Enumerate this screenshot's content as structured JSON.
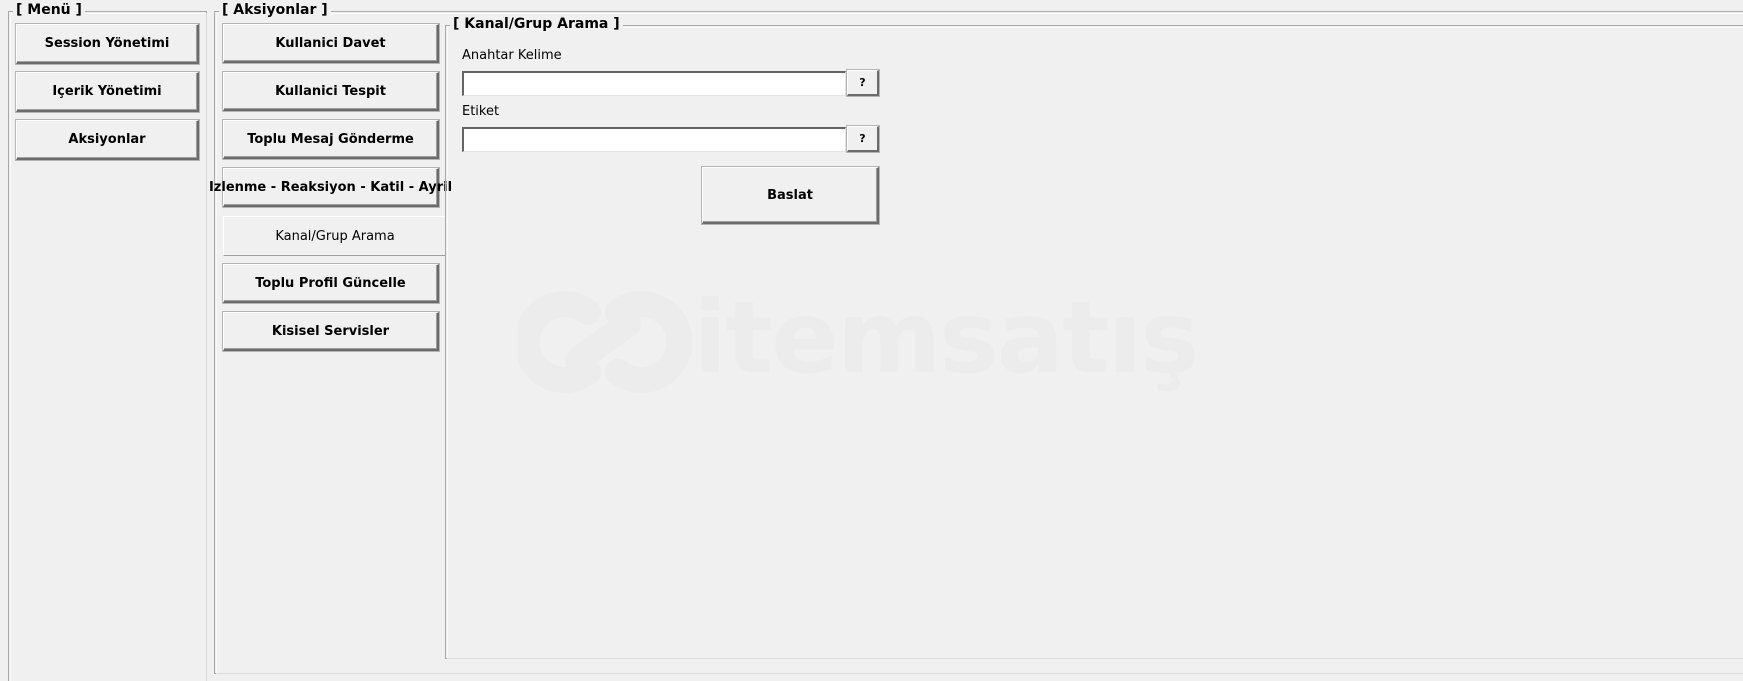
{
  "menu": {
    "title": "[ Menü ]",
    "items": [
      {
        "label": "Session Yönetimi"
      },
      {
        "label": "Içerik Yönetimi"
      },
      {
        "label": "Aksiyonlar"
      }
    ]
  },
  "actions": {
    "title": "[ Aksiyonlar ]",
    "tabs": [
      {
        "label": "Kullanici Davet"
      },
      {
        "label": "Kullanici Tespit"
      },
      {
        "label": "Toplu Mesaj Gönderme"
      },
      {
        "label": "Izlenme - Reaksiyon - Katil - Ayril"
      },
      {
        "label": "Kanal/Grup Arama",
        "active": true
      },
      {
        "label": "Toplu Profil Güncelle"
      },
      {
        "label": "Kisisel Servisler"
      }
    ]
  },
  "kanal_arama": {
    "title": "[ Kanal/Grup Arama ]",
    "keyword": {
      "label": "Anahtar Kelime",
      "value": ""
    },
    "tag": {
      "label": "Etiket",
      "value": ""
    },
    "help_label": "?",
    "start_label": "Baslat"
  },
  "watermark": {
    "text": "itemsatış"
  }
}
